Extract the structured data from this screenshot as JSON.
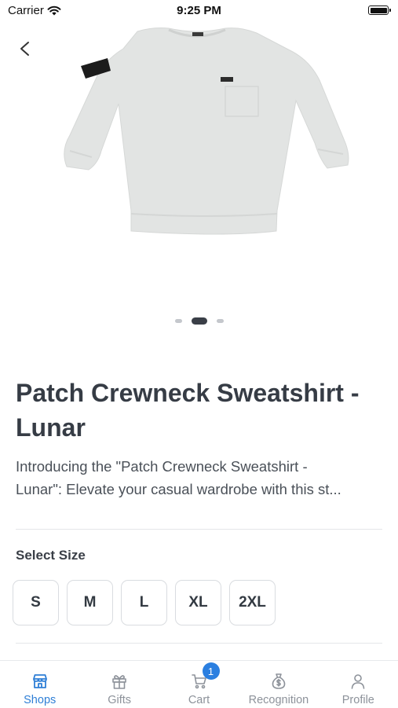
{
  "status_bar": {
    "carrier": "Carrier",
    "time": "9:25 PM"
  },
  "product": {
    "title": "Patch Crewneck Sweatshirt - Lunar",
    "description_lines": [
      "Introducing the \"Patch Crewneck Sweatshirt -",
      "Lunar\": Elevate your casual wardrobe with this st..."
    ],
    "image_pager": {
      "count": 3,
      "active_index": 1
    }
  },
  "size_section": {
    "label": "Select Size",
    "options": [
      "S",
      "M",
      "L",
      "XL",
      "2XL"
    ]
  },
  "tabbar": {
    "items": [
      {
        "label": "Shops",
        "icon": "shop-icon",
        "active": true
      },
      {
        "label": "Gifts",
        "icon": "gift-icon",
        "active": false
      },
      {
        "label": "Cart",
        "icon": "cart-icon",
        "active": false,
        "badge": "1"
      },
      {
        "label": "Recognition",
        "icon": "money-bag-icon",
        "active": false
      },
      {
        "label": "Profile",
        "icon": "person-icon",
        "active": false
      }
    ]
  },
  "colors": {
    "accent": "#2f7fd6",
    "badge": "#2b7fe0",
    "title": "#363c45"
  }
}
